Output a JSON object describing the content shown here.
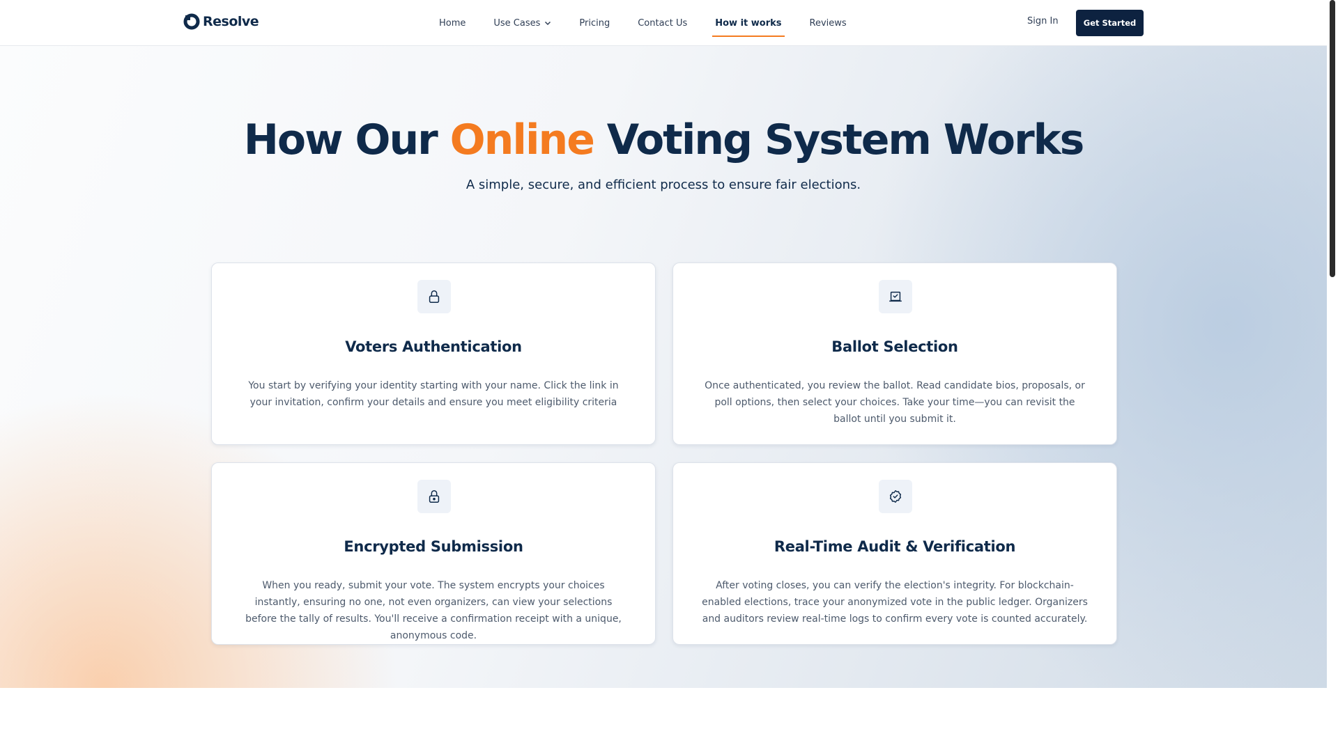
{
  "brand": {
    "name": "Resolve"
  },
  "nav": {
    "items": [
      {
        "label": "Home",
        "active": false,
        "has_dropdown": false
      },
      {
        "label": "Use Cases",
        "active": false,
        "has_dropdown": true
      },
      {
        "label": "Pricing",
        "active": false,
        "has_dropdown": false
      },
      {
        "label": "Contact Us",
        "active": false,
        "has_dropdown": false
      },
      {
        "label": "How it works",
        "active": true,
        "has_dropdown": false
      },
      {
        "label": "Reviews",
        "active": false,
        "has_dropdown": false
      }
    ],
    "sign_in": "Sign In",
    "cta": "Get Started"
  },
  "hero": {
    "title_before": "How Our ",
    "title_accent": "Online",
    "title_after": " Voting System Works",
    "subtitle": "A simple, secure, and efficient process to ensure fair elections."
  },
  "cards": [
    {
      "icon": "lock-icon",
      "title": "Voters Authentication",
      "body": "You start by verifying your identity starting with your name. Click the link in your invitation, confirm your details and ensure you meet eligibility criteria"
    },
    {
      "icon": "ballot-check-icon",
      "title": "Ballot Selection",
      "body": "Once authenticated, you review the ballot. Read candidate bios, proposals, or poll options, then select your choices. Take your time—you can revisit the ballot until you submit it."
    },
    {
      "icon": "lock-keyhole-icon",
      "title": "Encrypted Submission",
      "body": "When you ready, submit your vote. The system encrypts your choices instantly, ensuring no one, not even organizers, can view your selections before the tally of results. You'll receive a confirmation receipt with a unique, anonymous code."
    },
    {
      "icon": "badge-check-icon",
      "title": "Real-Time Audit & Verification",
      "body": "After voting closes, you can verify the election's integrity. For blockchain-enabled elections, trace your anonymized vote in the public ledger. Organizers and auditors review real-time logs to confirm every vote is counted accurately."
    }
  ],
  "colors": {
    "primary": "#0f2a4a",
    "accent": "#f47b20",
    "cta_bg": "#0d2240",
    "body_text": "#4d5a6c"
  }
}
